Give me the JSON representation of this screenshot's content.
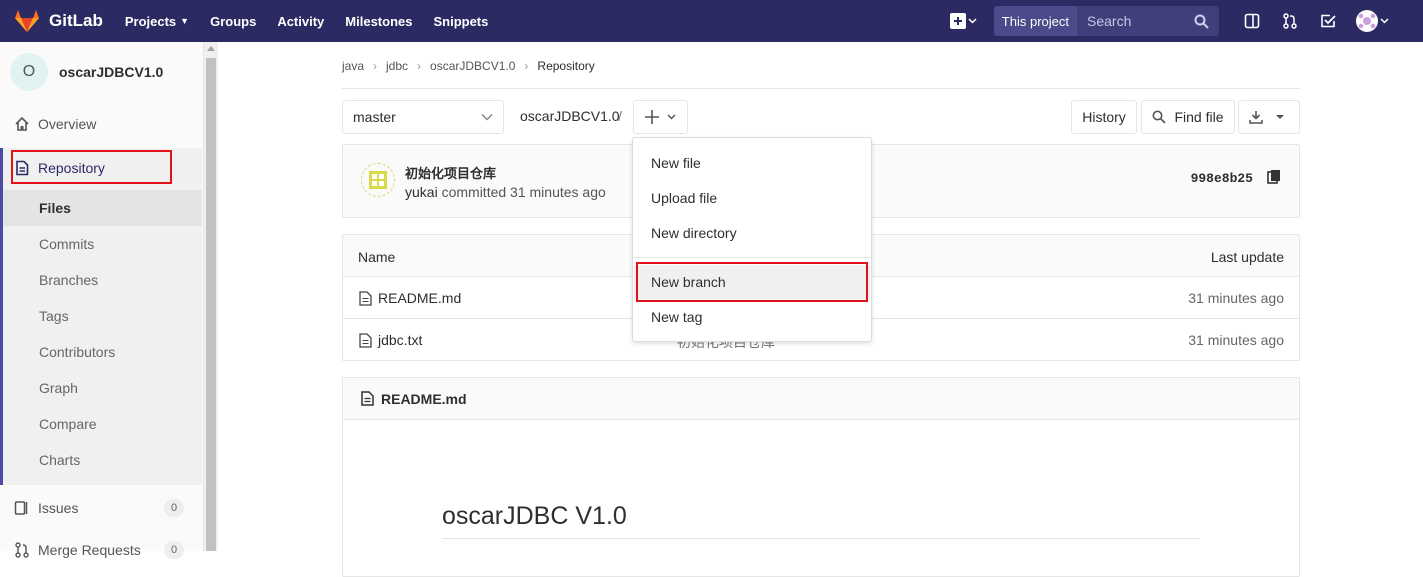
{
  "topnav": {
    "brand": "GitLab",
    "links": [
      "Projects",
      "Groups",
      "Activity",
      "Milestones",
      "Snippets"
    ],
    "scope": "This project",
    "search_placeholder": "Search"
  },
  "sidebar": {
    "project_initial": "O",
    "project_name": "oscarJDBCV1.0",
    "overview": "Overview",
    "repository": "Repository",
    "sub_items": [
      "Files",
      "Commits",
      "Branches",
      "Tags",
      "Contributors",
      "Graph",
      "Compare",
      "Charts"
    ],
    "issues": "Issues",
    "issues_count": "0",
    "merge_requests": "Merge Requests",
    "merge_requests_count": "0"
  },
  "breadcrumb": [
    "java",
    "jdbc",
    "oscarJDBCV1.0",
    "Repository"
  ],
  "toolbar": {
    "branch": "master",
    "path_root": "oscarJDBCV1.0",
    "path_sep": "/",
    "history": "History",
    "find_file": "Find file"
  },
  "commit": {
    "title": "初始化项目仓库",
    "author": "yukai",
    "action": "committed",
    "time": "31 minutes ago",
    "sha": "998e8b25"
  },
  "files_table": {
    "headers": {
      "name": "Name",
      "last_update": "Last update"
    },
    "rows": [
      {
        "name": "README.md",
        "message": "",
        "updated": "31 minutes ago"
      },
      {
        "name": "jdbc.txt",
        "message": "初始化项目仓库",
        "updated": "31 minutes ago"
      }
    ]
  },
  "readme": {
    "file": "README.md",
    "heading": "oscarJDBC V1.0"
  },
  "dropdown": {
    "items": [
      "New file",
      "Upload file",
      "New directory",
      "New branch",
      "New tag"
    ]
  },
  "colors": {
    "navbar": "#2b2a63",
    "highlight_box": "#e0131b",
    "active_border": "#4b4ba3"
  }
}
